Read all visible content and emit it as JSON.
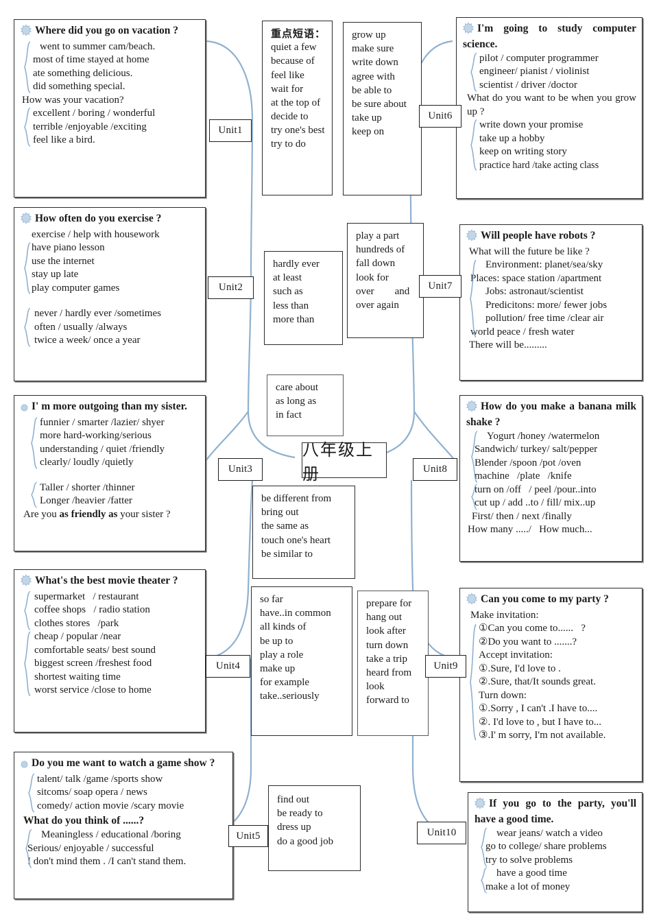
{
  "center_title": "八年级上册",
  "unit_labels": {
    "u1": "Unit1",
    "u2": "Unit2",
    "u3": "Unit3",
    "u4": "Unit4",
    "u5": "Unit5",
    "u6": "Unit6",
    "u7": "Unit7",
    "u8": "Unit8",
    "u9": "Unit9",
    "u10": "Unit10"
  },
  "units": {
    "unit1": {
      "heading": "Where did you go on vacation ?",
      "group1": [
        "went to summer cam/beach.",
        "most of time stayed at home",
        "ate something delicious.",
        "did something special."
      ],
      "line": "How was your vacation?",
      "group2": [
        "excellent / boring / wonderful",
        "terrible /enjoyable /exciting",
        "feel like a bird."
      ]
    },
    "unit2": {
      "heading": "How often do you exercise  ?",
      "lead": "exercise / help with housework",
      "group1": [
        "have piano lesson",
        "use the internet",
        "stay up late",
        "play computer games"
      ],
      "group2": [
        "never / hardly ever /sometimes",
        "often / usually /always",
        "twice a week/ once a year"
      ]
    },
    "unit3": {
      "heading": "I' m more outgoing than my sister.",
      "group1": [
        "funnier / smarter /lazier/ shyer",
        "more hard-working/serious",
        "understanding / quiet /friendly",
        "clearly/ loudly /quietly"
      ],
      "group2": [
        "Taller / shorter /thinner",
        "Longer /heavier /fatter"
      ],
      "footer_pre": "Are you ",
      "footer_bold": "as friendly as",
      "footer_post": " your sister ?"
    },
    "unit4": {
      "heading": "What's the best movie theater ?",
      "group1": [
        "supermarket   / restaurant",
        "coffee shops   / radio station",
        "clothes stores   /park"
      ],
      "group2": [
        "cheap / popular /near",
        "comfortable seats/ best sound",
        "biggest screen /freshest food",
        "shortest waiting time",
        "worst service /close to home"
      ]
    },
    "unit5": {
      "heading": "Do you me want to watch a game show ?",
      "group1": [
        "talent/ talk /game /sports show",
        "sitcoms/ soap opera / news",
        "comedy/ action movie /scary movie"
      ],
      "heading2": "What do you think of ......?",
      "group2": [
        "Meaningless / educational /boring",
        "Serious/ enjoyable / successful",
        "I don't mind them . /I can't stand them."
      ]
    },
    "unit6": {
      "heading": "I'm going to study computer science.",
      "group1": [
        "pilot / computer programmer",
        "engineer/ pianist / violinist",
        "scientist / driver /doctor"
      ],
      "line": "What do you want to be when you grow up ?",
      "group2": [
        "write down your promise",
        "take up a hobby",
        "keep on writing story",
        "practice hard /take acting class"
      ]
    },
    "unit7": {
      "heading": "Will people have robots ?",
      "line": "What will the future be like ?",
      "group1": [
        "Environment: planet/sea/sky",
        "Places: space station /apartment",
        "Jobs: astronaut/scientist",
        "Predicitons: more/ fewer jobs",
        "pollution/ free time /clear air",
        "world peace / fresh water"
      ],
      "footer": "There will be........."
    },
    "unit8": {
      "heading": "How do you make a banana milk shake ?",
      "group1": [
        "Yogurt /honey /watermelon",
        "Sandwich/ turkey/ salt/pepper",
        "Blender /spoon /pot /oven",
        "machine   /plate   /knife"
      ],
      "group2": [
        "turn on /off   / peel /pour..into",
        "cut up / add ..to / fill/ mix..up"
      ],
      "footer1": "First/ then / next /finally",
      "footer2": "How many ...../   How much..."
    },
    "unit9": {
      "heading": "Can you come to my party ?",
      "l1": "Make invitation:",
      "l2": "①Can you come to......   ?",
      "l3": "②Do you want to .......?",
      "l4": "Accept invitation:",
      "l5": "①.Sure, I'd love to .",
      "l6": "②.Sure, that/It sounds great.",
      "l7": "Turn down:",
      "l8": "①.Sorry , I can't .I have to....",
      "l9": "②. I'd love to , but I have to...",
      "l10": "③.I' m sorry, I'm not available."
    },
    "unit10": {
      "heading": "If you go to the party, you'll have a good time.",
      "group1": [
        "wear jeans/ watch a video",
        "go to college/ share problems",
        "try to solve problems"
      ],
      "group2": [
        "have a good time",
        "make a lot of money"
      ]
    }
  },
  "phrase_boxes": {
    "key_phrases": {
      "title": "重点短语：",
      "items": [
        "quiet a few",
        "because of",
        "feel like",
        "wait for",
        "at the top of",
        "decide to",
        "try one's best",
        "try to do"
      ]
    },
    "grow_up": {
      "items": [
        "grow up",
        "make sure",
        "write down",
        "agree with",
        "be able to",
        "be sure about",
        "take up",
        "keep on"
      ]
    },
    "hardly_ever": {
      "items": [
        "hardly ever",
        "at least",
        "such as",
        "less than",
        "more than"
      ]
    },
    "play_a_part": {
      "items": [
        "play a part",
        "hundreds of",
        "fall down",
        "look for",
        "over        and",
        "over again"
      ]
    },
    "care_about": {
      "items": [
        "care about",
        "as long as",
        "in fact"
      ]
    },
    "be_different_from": {
      "items": [
        "be different from",
        "bring out",
        "the same as",
        "touch one's heart",
        "be similar to"
      ]
    },
    "so_far": {
      "items": [
        "so far",
        "have..in common",
        "all kinds of",
        "be up to",
        "play a role",
        "make up",
        "for example",
        "take..seriously"
      ]
    },
    "prepare_for": {
      "items": [
        "prepare for",
        "hang out",
        "look after",
        "turn down",
        "take a trip",
        "heard from",
        "look",
        "forward to"
      ]
    },
    "find_out": {
      "items": [
        "find out",
        "be ready to",
        "dress up",
        "do a good job"
      ]
    }
  },
  "colors": {
    "connector": "#8fb0cf",
    "brace": "#8fb0cf",
    "bullet": "#b9cee2",
    "border": "#2b2b2b"
  },
  "icons": {
    "bullet": "star-burst-icon"
  }
}
